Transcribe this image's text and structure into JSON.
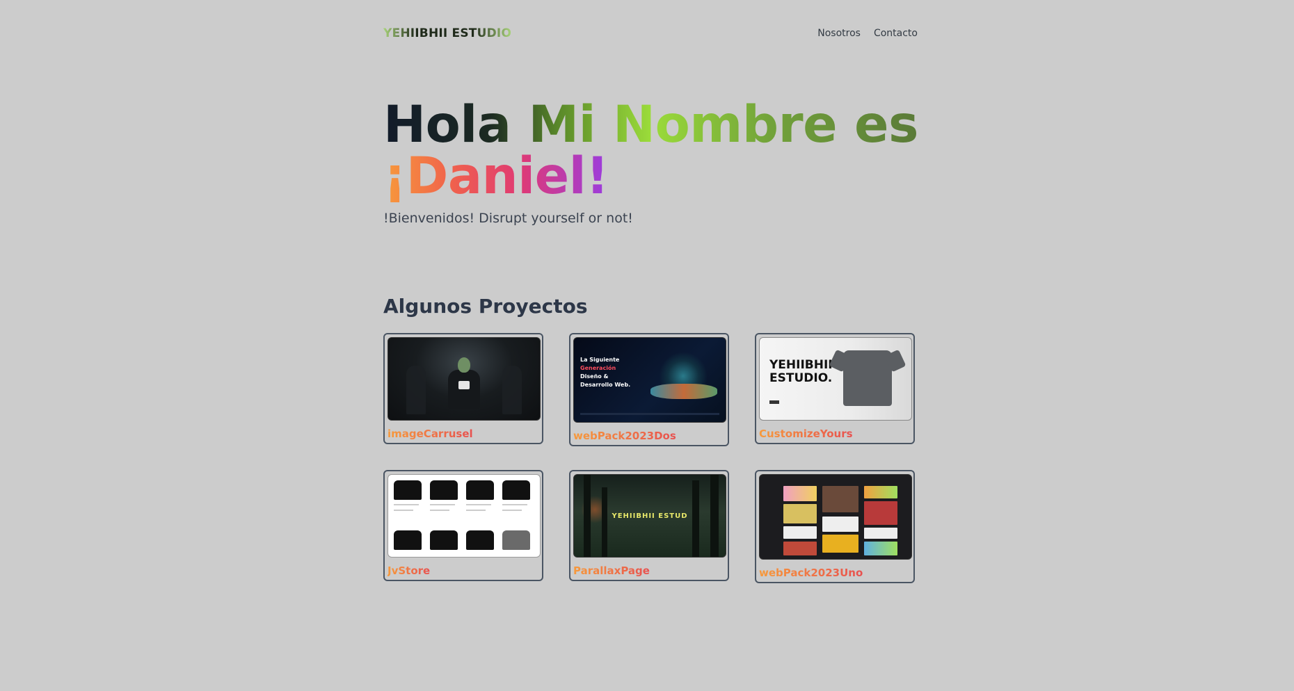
{
  "header": {
    "logo": "YEHIIBHII ESTUDIO",
    "nav": [
      {
        "label": "Nosotros"
      },
      {
        "label": "Contacto"
      }
    ]
  },
  "hero": {
    "line1": "Hola Mi Nombre es",
    "line2": "¡Daniel!",
    "subtitle": "!Bienvenidos! Disrupt yourself or not!"
  },
  "projects": {
    "title": "Algunos Proyectos",
    "items": [
      {
        "label": "imageCarrusel"
      },
      {
        "label": "webPack2023Dos"
      },
      {
        "label": "CustomizeYours"
      },
      {
        "label": "JvStore"
      },
      {
        "label": "ParallaxPage"
      },
      {
        "label": "webPack2023Uno"
      }
    ]
  },
  "thumbs": {
    "webpack2": {
      "l1": "La Siguiente",
      "l2": "Generación",
      "l3": "Diseño &",
      "l4": "Desarrollo Web."
    },
    "custom": {
      "l1": "YEHIIBHII",
      "l2": "ESTUDIO."
    },
    "parallax": {
      "text": "YEHIIBHII ESTUD"
    }
  },
  "colors": {
    "background": "#cccccc",
    "card_border": "#4a5563",
    "label_gradient_start": "#f79a3b",
    "label_gradient_end": "#e8504f"
  }
}
